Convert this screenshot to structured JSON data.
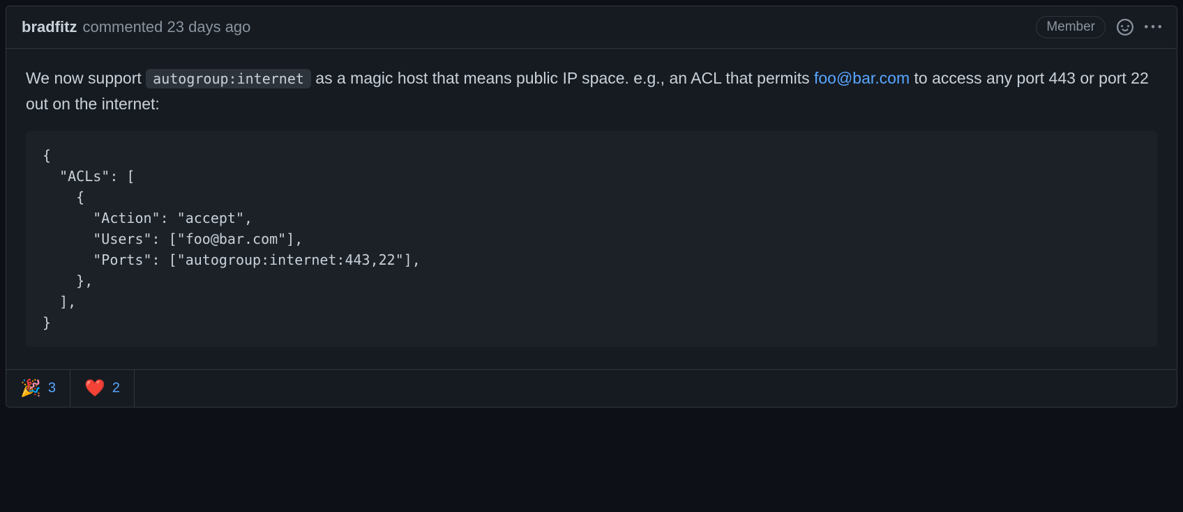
{
  "header": {
    "author": "bradfitz",
    "action": "commented",
    "timestamp": "23 days ago",
    "badge": "Member"
  },
  "body": {
    "text_before_code": "We now support ",
    "inline_code": "autogroup:internet",
    "text_after_code": " as a magic host that means public IP space. e.g., an ACL that permits ",
    "link_text": "foo@bar.com",
    "text_after_link": " to access any port 443 or port 22 out on the internet:",
    "code_block": "{\n  \"ACLs\": [\n    {\n      \"Action\": \"accept\",\n      \"Users\": [\"foo@bar.com\"],\n      \"Ports\": [\"autogroup:internet:443,22\"],\n    },\n  ],\n}"
  },
  "reactions": [
    {
      "emoji": "🎉",
      "count": "3"
    },
    {
      "emoji": "❤️",
      "count": "2"
    }
  ]
}
